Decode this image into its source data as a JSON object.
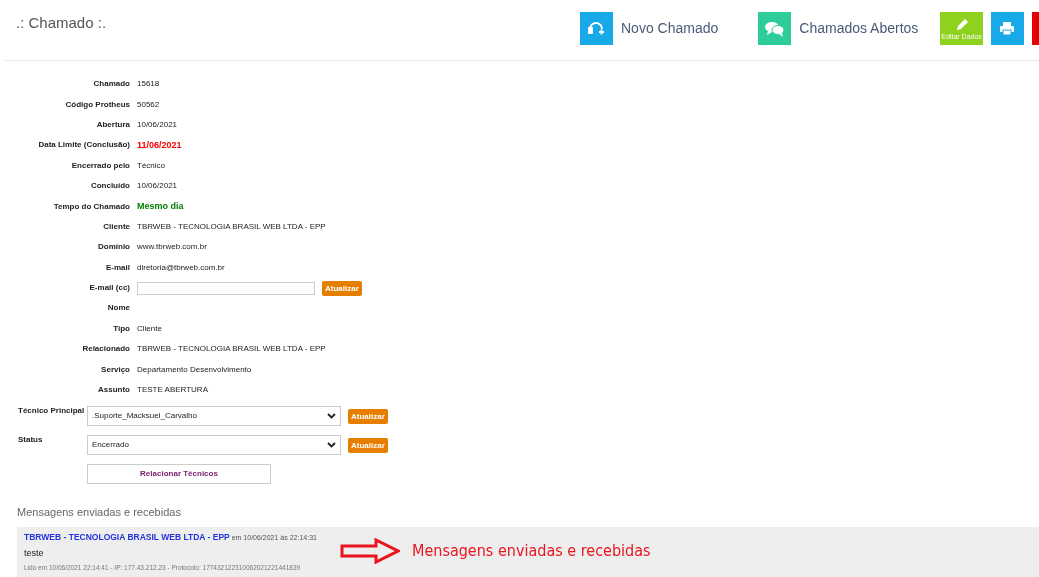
{
  "page_title": ".: Chamado :.",
  "header_buttons": [
    {
      "kind": "support",
      "label": "Novo Chamado"
    },
    {
      "kind": "chat",
      "label": "Chamados Abertos"
    },
    {
      "kind": "edit",
      "label": "Editar Dados"
    },
    {
      "kind": "print"
    },
    {
      "kind": "power"
    }
  ],
  "fields": [
    {
      "kind": "text",
      "label": "Chamado",
      "value": "15618"
    },
    {
      "kind": "text",
      "label": "Código Protheus",
      "value": "50562"
    },
    {
      "kind": "text",
      "label": "Abertura",
      "value": "10/06/2021"
    },
    {
      "kind": "text",
      "label": "Data Limite (Conclusão)",
      "value": "11/06/2021",
      "color": "#ff0000"
    },
    {
      "kind": "text",
      "label": "Encerrado pelo",
      "value": "Técnico"
    },
    {
      "kind": "text",
      "label": "Concluído",
      "value": "10/06/2021"
    },
    {
      "kind": "text",
      "label": "Tempo do Chamado",
      "value": "Mesmo dia",
      "color": "#008000"
    },
    {
      "kind": "text",
      "label": "Cliente",
      "value": "TBRWEB - TECNOLOGIA BRASIL WEB LTDA - EPP"
    },
    {
      "kind": "text",
      "label": "Domínio",
      "value": "www.tbrweb.com.br"
    },
    {
      "kind": "text",
      "label": "E-mail",
      "value": "diretoria@tbrweb.com.br"
    },
    {
      "kind": "input",
      "label": "E-mail (cc)",
      "button": "Atualizar"
    },
    {
      "kind": "text",
      "label": "Nome"
    },
    {
      "kind": "text",
      "label": "Tipo",
      "value": "Cliente"
    },
    {
      "kind": "text",
      "label": "Relacionado",
      "value": "TBRWEB - TECNOLOGIA BRASIL WEB LTDA - EPP"
    },
    {
      "kind": "text",
      "label": "Serviço",
      "value": "Departamento Desenvolvimento"
    },
    {
      "kind": "text",
      "label": "Assunto",
      "value": "TESTE ABERTURA"
    }
  ],
  "selects": [
    {
      "label": "Técnico Principal",
      "value": ".Suporte_Macksuel_Carvalho",
      "button": "Atualizar"
    },
    {
      "label": "Status",
      "value": "Encerrado",
      "button": "Atualizar"
    }
  ],
  "relate_button": "Relacionar Técnicos",
  "messages_title": "Mensagens enviadas e recebidas",
  "messages": [
    {
      "author": "TBRWEB - TECNOLOGIA BRASIL WEB LTDA - EPP",
      "date": "em 10/06/2021 às 22:14:31",
      "text": "teste",
      "meta": "Lido em 10/06/2021 22:14:41 - IP: 177.43.212.23 - Protocolo: 17743212231006202122144183​9"
    }
  ],
  "annotation": "Mensagens enviadas e recebidas"
}
